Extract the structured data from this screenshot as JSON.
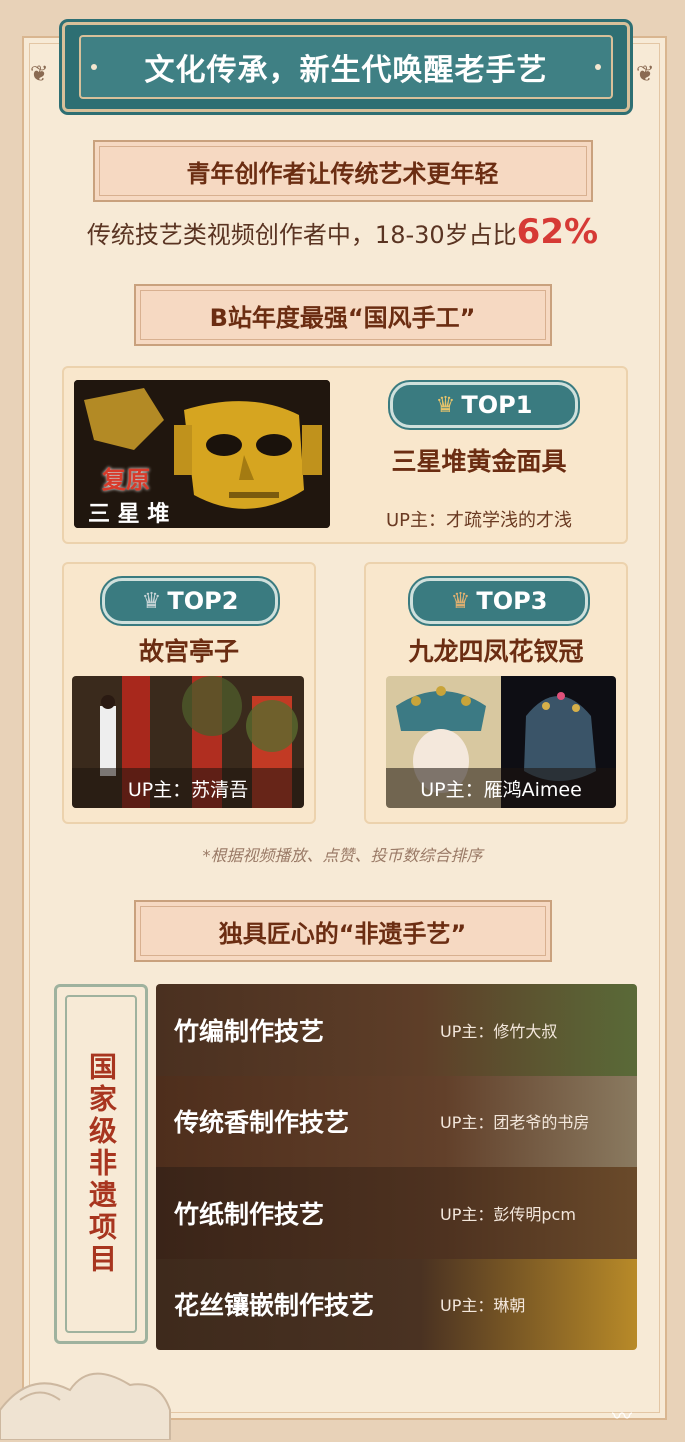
{
  "header": {
    "title": "文化传承，新生代唤醒老手艺"
  },
  "section1": {
    "heading": "青年创作者让传统艺术更年轻",
    "stat_text": "传统技艺类视频创作者中，18-30岁占比",
    "stat_value": "62%"
  },
  "section2": {
    "heading": "B站年度最强“国风手工”",
    "top1": {
      "badge": "TOP1",
      "title": "三星堆黄金面具",
      "up": "UP主：才疏学浅的才浅",
      "image_text_1": "复原",
      "image_text_2": "三 星 堆"
    },
    "top2": {
      "badge": "TOP2",
      "title": "故宫亭子",
      "up": "UP主：苏清吾"
    },
    "top3": {
      "badge": "TOP3",
      "title": "九龙四凤花钗冠",
      "up": "UP主：雁鸿Aimee"
    },
    "note": "*根据视频播放、点赞、投币数综合排序"
  },
  "section3": {
    "heading": "独具匠心的“非遗手艺”",
    "side_label": "国家级非遗项目",
    "crafts": [
      {
        "name": "竹编制作技艺",
        "up": "UP主：修竹大叔"
      },
      {
        "name": "传统香制作技艺",
        "up": "UP主：团老爷的书房"
      },
      {
        "name": "竹纸制作技艺",
        "up": "UP主：彭传明pcm"
      },
      {
        "name": "花丝镶嵌制作技艺",
        "up": "UP主：琳朝"
      }
    ]
  },
  "colors": {
    "teal": "#3a7b80",
    "accent_red": "#d63a35",
    "brown_text": "#6b2d12",
    "gold_crown": "#e8c46a",
    "silver_crown": "#c8d4d6",
    "bronze_crown": "#e0b070"
  },
  "icons": [
    "crown-icon",
    "corner-ornament-icon",
    "cloud-ornament-icon",
    "bird-icon"
  ]
}
